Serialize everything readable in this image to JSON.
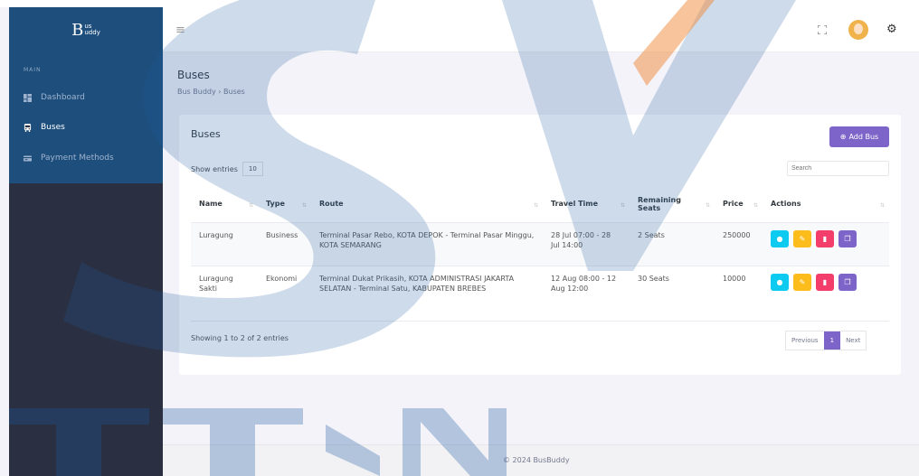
{
  "brand": {
    "letter": "B",
    "top": "us",
    "bottom": "uddy"
  },
  "sidebar": {
    "section": "MAIN",
    "items": [
      {
        "label": "Dashboard",
        "icon": "dashboard-icon",
        "active": false
      },
      {
        "label": "Buses",
        "icon": "bus-icon",
        "active": true
      },
      {
        "label": "Payment Methods",
        "icon": "card-icon",
        "active": false
      }
    ]
  },
  "page": {
    "title": "Buses",
    "breadcrumb": [
      "Bus Buddy",
      "Buses"
    ]
  },
  "card": {
    "title": "Buses",
    "add_label": "Add Bus",
    "show_label": "Show entries",
    "entries_value": "10",
    "search_placeholder": "Search",
    "columns": [
      "Name",
      "Type",
      "Route",
      "Travel Time",
      "Remaining Seats",
      "Price",
      "Actions"
    ],
    "rows": [
      {
        "name": "Luragung",
        "type": "Business",
        "route": "Terminal Pasar Rebo, KOTA DEPOK - Terminal Pasar Minggu, KOTA SEMARANG",
        "time": "28 Jul 07:00 - 28 Jul 14:00",
        "seats": "2 Seats",
        "price": "250000"
      },
      {
        "name": "Luragung Sakti",
        "type": "Ekonomi",
        "route": "Terminal Dukat Prikasih, KOTA ADMINISTRASI JAKARTA SELATAN - Terminal Satu, KABUPATEN BREBES",
        "time": "12 Aug 08:00 - 12 Aug 12:00",
        "seats": "30 Seats",
        "price": "10000"
      }
    ],
    "info": "Showing 1 to 2 of 2 entries",
    "pager": {
      "prev": "Previous",
      "current": "1",
      "next": "Next"
    }
  },
  "footer": "© 2024 BusBuddy",
  "colors": {
    "sidebar": "#2a3042",
    "sidebar_top": "#1e4f7c",
    "primary": "#7d64c8",
    "view": "#0dcaf0",
    "edit": "#fcbc1c",
    "delete": "#f33d6b"
  }
}
